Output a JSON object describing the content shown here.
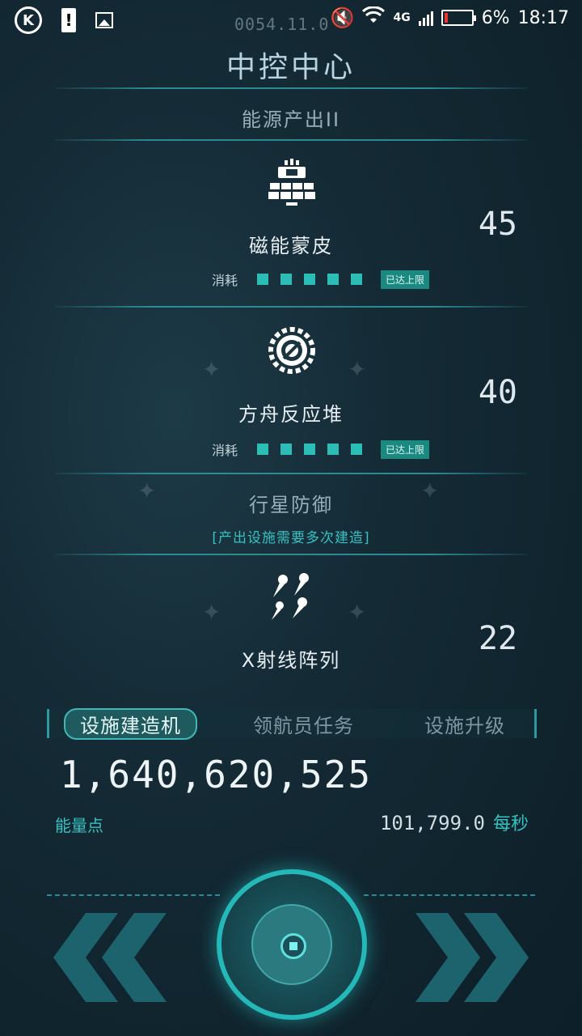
{
  "statusbar": {
    "date": "0054.11.0",
    "network": "4G",
    "battery": "6%",
    "time": "18:17",
    "icons": [
      "k-app-icon",
      "alert-icon",
      "image-icon",
      "mute-icon",
      "wifi-icon",
      "signal-icon",
      "battery-icon"
    ]
  },
  "page": {
    "title": "中控中心",
    "section1_heading": "能源产出II",
    "section2_heading": "行星防御",
    "section2_note": "[产出设施需要多次建造]"
  },
  "facilities": [
    {
      "name": "磁能蒙皮",
      "count": "45",
      "icon": "solar-panel-icon",
      "consume_label": "消耗",
      "consume_level": 5,
      "status": "已达上限"
    },
    {
      "name": "方舟反应堆",
      "count": "40",
      "icon": "reactor-gear-icon",
      "consume_label": "消耗",
      "consume_level": 5,
      "status": "已达上限"
    },
    {
      "name": "X射线阵列",
      "count": "22",
      "icon": "xray-array-icon"
    }
  ],
  "tabs": [
    {
      "label": "设施建造机",
      "active": true
    },
    {
      "label": "领航员任务",
      "active": false
    },
    {
      "label": "设施升级",
      "active": false
    }
  ],
  "energy": {
    "value": "1,640,620,525",
    "label": "能量点",
    "rate_value": "101,799.0",
    "rate_unit": "每秒"
  },
  "colors": {
    "accent": "#34c2c2",
    "background": "#142a35",
    "battery_low": "#ee3333"
  }
}
